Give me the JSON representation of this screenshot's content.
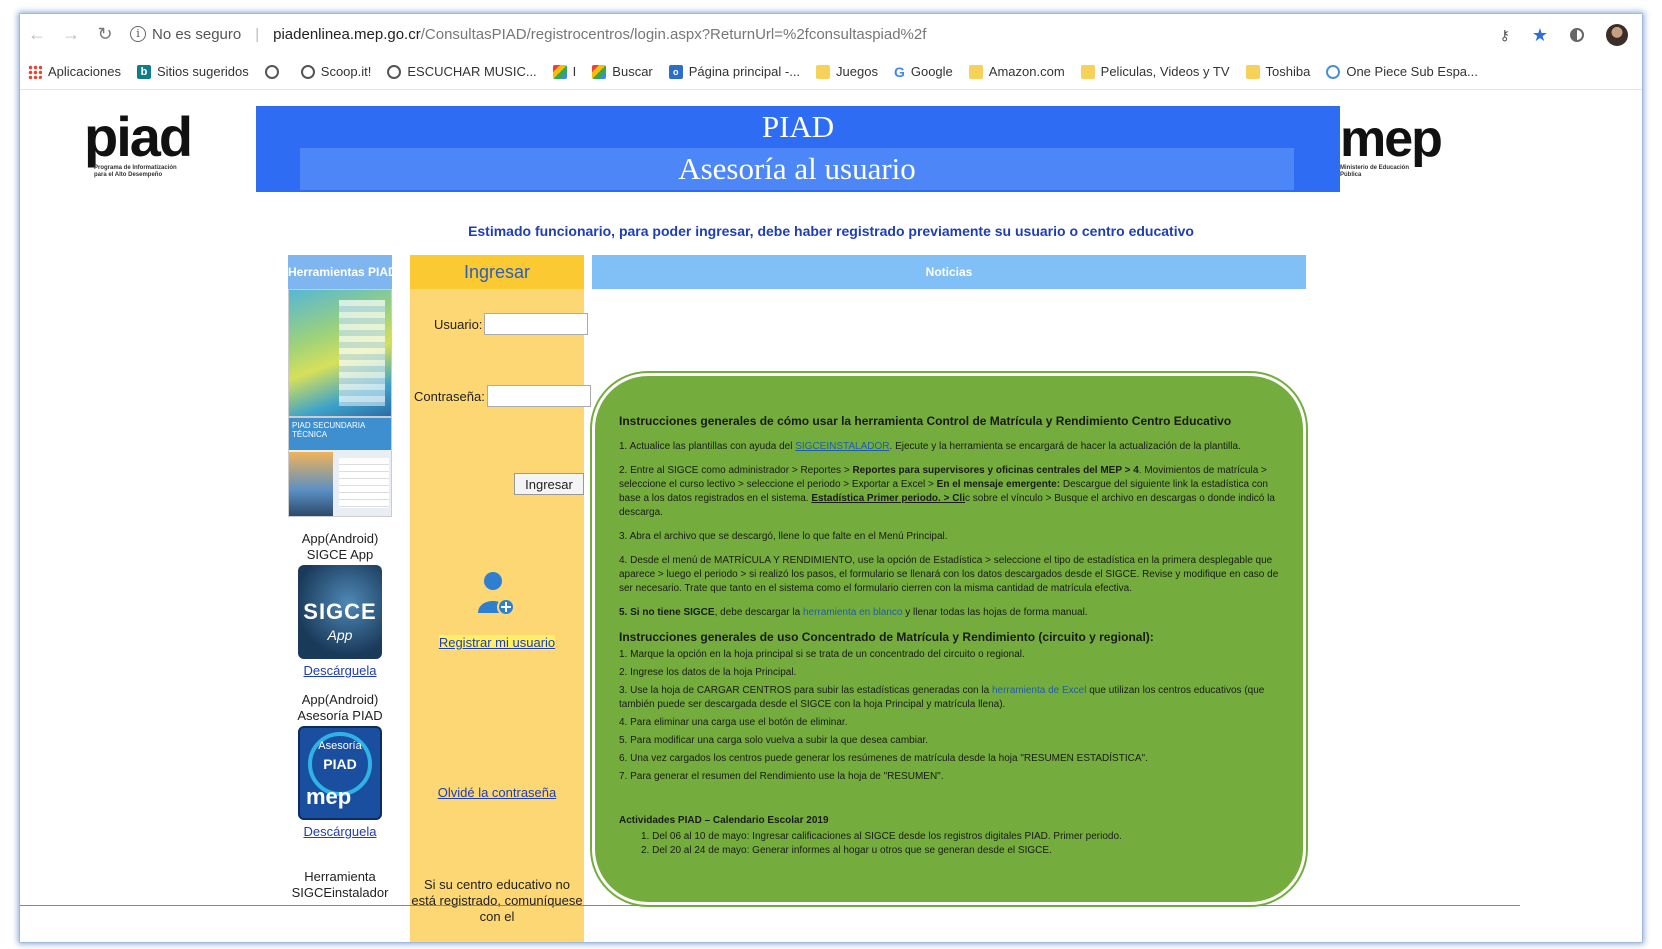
{
  "browser": {
    "security_label": "No es seguro",
    "url_host": "piadenlinea.mep.go.cr",
    "url_path": "/ConsultasPIAD/registrocentros/login.aspx?ReturnUrl=%2fconsultaspiad%2f",
    "bookmarks": [
      {
        "icon": "apps-icon",
        "label": "Aplicaciones"
      },
      {
        "icon": "bing-icon",
        "label": "Sitios sugeridos"
      },
      {
        "icon": "globe-icon",
        "label": ""
      },
      {
        "icon": "globe-icon",
        "label": "Scoop.it!"
      },
      {
        "icon": "globe-icon",
        "label": "ESCUCHAR MUSIC..."
      },
      {
        "icon": "square-icon",
        "label": "I"
      },
      {
        "icon": "square-icon",
        "label": "Buscar"
      },
      {
        "icon": "outlook-icon",
        "label": "Página principal -..."
      },
      {
        "icon": "folder-icon",
        "label": "Juegos"
      },
      {
        "icon": "google-icon",
        "label": "Google"
      },
      {
        "icon": "folder-icon",
        "label": "Amazon.com"
      },
      {
        "icon": "folder-icon",
        "label": "Peliculas, Videos y TV"
      },
      {
        "icon": "folder-icon",
        "label": "Toshiba"
      },
      {
        "icon": "circle-icon",
        "label": "One Piece Sub Espa..."
      }
    ]
  },
  "header": {
    "piad_logo": "piad",
    "piad_logo_sub": "Programa de Informatización para el Alto Desempeño",
    "title": "PIAD",
    "subtitle": "Asesoría al usuario",
    "mep_logo": "mep",
    "mep_logo_sub": "Ministerio de Educación Pública"
  },
  "notice": "Estimado funcionario, para poder ingresar, debe haber registrado previamente su usuario o centro educativo",
  "tools": {
    "heading": "Herramientas PIAD",
    "banner_text": "PIAD SECUNDARIA TÉCNICA",
    "app1_label": "App(Android) SIGCE App",
    "app1_tile_title": "SIGCE",
    "app1_tile_sub": "App",
    "app1_download": "Descárguela",
    "app2_label": "App(Android) Asesoría PIAD",
    "app2_tile_t1": "Asesoría",
    "app2_tile_t2": "PIAD",
    "app2_tile_t3": "mep",
    "app2_download": "Descárguela",
    "tool3_label": "Herramienta SIGCEinstalador"
  },
  "login": {
    "heading": "Ingresar",
    "user_label": "Usuario:",
    "user_value": "",
    "password_label": "Contraseña:",
    "password_value": "",
    "submit": "Ingresar",
    "register": "Registrar mi usuario",
    "forgot": "Olvidé la contraseña",
    "note": "Si su centro educativo no está registrado, comuníquese con el"
  },
  "news": {
    "heading": "Noticias",
    "title1": "Instrucciones generales de cómo usar la herramienta Control de Matrícula y Rendimiento Centro Educativo",
    "s1_pre": "1. Actualice las plantillas con ayuda del ",
    "s1_link": "SIGCEINSTALADOR",
    "s1_post": ". Ejecute y la herramienta se encargará de hacer la actualización de la plantilla.",
    "s2_a": "2. Entre al SIGCE como administrador > Reportes > ",
    "s2_b": "Reportes para supervisores y oficinas centrales del MEP > 4",
    "s2_c": ". Movimientos de matrícula > seleccione el curso lectivo > seleccione el periodo > Exportar a Excel > ",
    "s2_d": "En el mensaje emergente:",
    "s2_e": " Descargue del siguiente link la estadística con base a los datos registrados en el sistema. ",
    "s2_f": "Estadística Primer periodo. > Cli",
    "s2_g": "c sobre el vínculo > Busque el archivo en descargas o donde indicó la descarga.",
    "s3": "3. Abra el archivo que se descargó, llene lo que falte en el Menú Principal.",
    "s4": "4. Desde el menú de MATRÍCULA Y RENDIMIENTO, use la opción de Estadística > seleccione el tipo de estadística en la primera desplegable que aparece > luego el periodo > si realizó los pasos, el formulario se llenará con los datos descargados desde el SIGCE. Revise y modifique en caso de ser necesario. Trate que tanto en el sistema como el formulario cierren con la misma cantidad de matrícula efectiva.",
    "s5_a": "5. Si no tiene SIGCE",
    "s5_b": ", debe descargar la ",
    "s5_link": "herramienta en blanco",
    "s5_c": " y llenar todas las hojas de forma manual.",
    "title2": "Instrucciones generales de uso Concentrado de Matrícula y Rendimiento (circuito y regional):",
    "c1": "1. Marque la opción en la hoja principal si se trata de un concentrado del circuito o regional.",
    "c2": "2. Ingrese los datos de la hoja Principal.",
    "c3_pre": "3. Use la hoja de CARGAR CENTROS para subir las estadísticas generadas con la ",
    "c3_link": "herramienta de Excel",
    "c3_post": " que utilizan los centros educativos (que también puede ser descargada desde el SIGCE con la hoja Principal y matrícula llena).",
    "c4": "4. Para eliminar una carga use el botón de eliminar.",
    "c5": "5. Para modificar una carga solo vuelva a subir la que desea cambiar.",
    "c6": "6. Una vez cargados los centros puede generar los resúmenes de matrícula desde la hoja \"RESUMEN ESTADÍSTICA\".",
    "c7": "7. Para generar el resumen del Rendimiento use la hoja de \"RESUMEN\".",
    "act_title": "Actividades PIAD – Calendario Escolar 2019",
    "act1": "1.     Del 06 al 10 de mayo: Ingresar calificaciones al SIGCE desde los registros digitales PIAD. Primer periodo.",
    "act2": "2.     Del 20 al 24 de mayo: Generar informes al hogar u otros que se generan desde el SIGCE."
  }
}
